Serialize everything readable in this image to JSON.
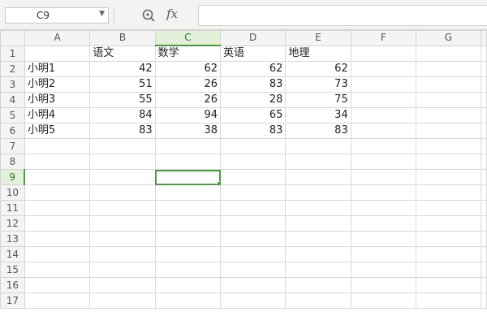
{
  "formula_bar": {
    "name_box": "C9",
    "fx_label": "fx",
    "formula_value": ""
  },
  "sheet": {
    "active_cell": "C9",
    "active_color": "#4a9a3f",
    "columns": [
      "A",
      "B",
      "C",
      "D",
      "E",
      "F",
      "G"
    ],
    "rows": [
      [
        "",
        "语文",
        "数学",
        "英语",
        "地理",
        "",
        ""
      ],
      [
        "小明1",
        "42",
        "62",
        "62",
        "62",
        "",
        ""
      ],
      [
        "小明2",
        "51",
        "26",
        "83",
        "73",
        "",
        ""
      ],
      [
        "小明3",
        "55",
        "26",
        "28",
        "75",
        "",
        ""
      ],
      [
        "小明4",
        "84",
        "94",
        "65",
        "34",
        "",
        ""
      ],
      [
        "小明5",
        "83",
        "38",
        "83",
        "83",
        "",
        ""
      ],
      [
        "",
        "",
        "",
        "",
        "",
        "",
        ""
      ],
      [
        "",
        "",
        "",
        "",
        "",
        "",
        ""
      ],
      [
        "",
        "",
        "",
        "",
        "",
        "",
        ""
      ],
      [
        "",
        "",
        "",
        "",
        "",
        "",
        ""
      ],
      [
        "",
        "",
        "",
        "",
        "",
        "",
        ""
      ],
      [
        "",
        "",
        "",
        "",
        "",
        "",
        ""
      ],
      [
        "",
        "",
        "",
        "",
        "",
        "",
        ""
      ],
      [
        "",
        "",
        "",
        "",
        "",
        "",
        ""
      ],
      [
        "",
        "",
        "",
        "",
        "",
        "",
        ""
      ],
      [
        "",
        "",
        "",
        "",
        "",
        "",
        ""
      ],
      [
        "",
        "",
        "",
        "",
        "",
        "",
        ""
      ]
    ]
  }
}
